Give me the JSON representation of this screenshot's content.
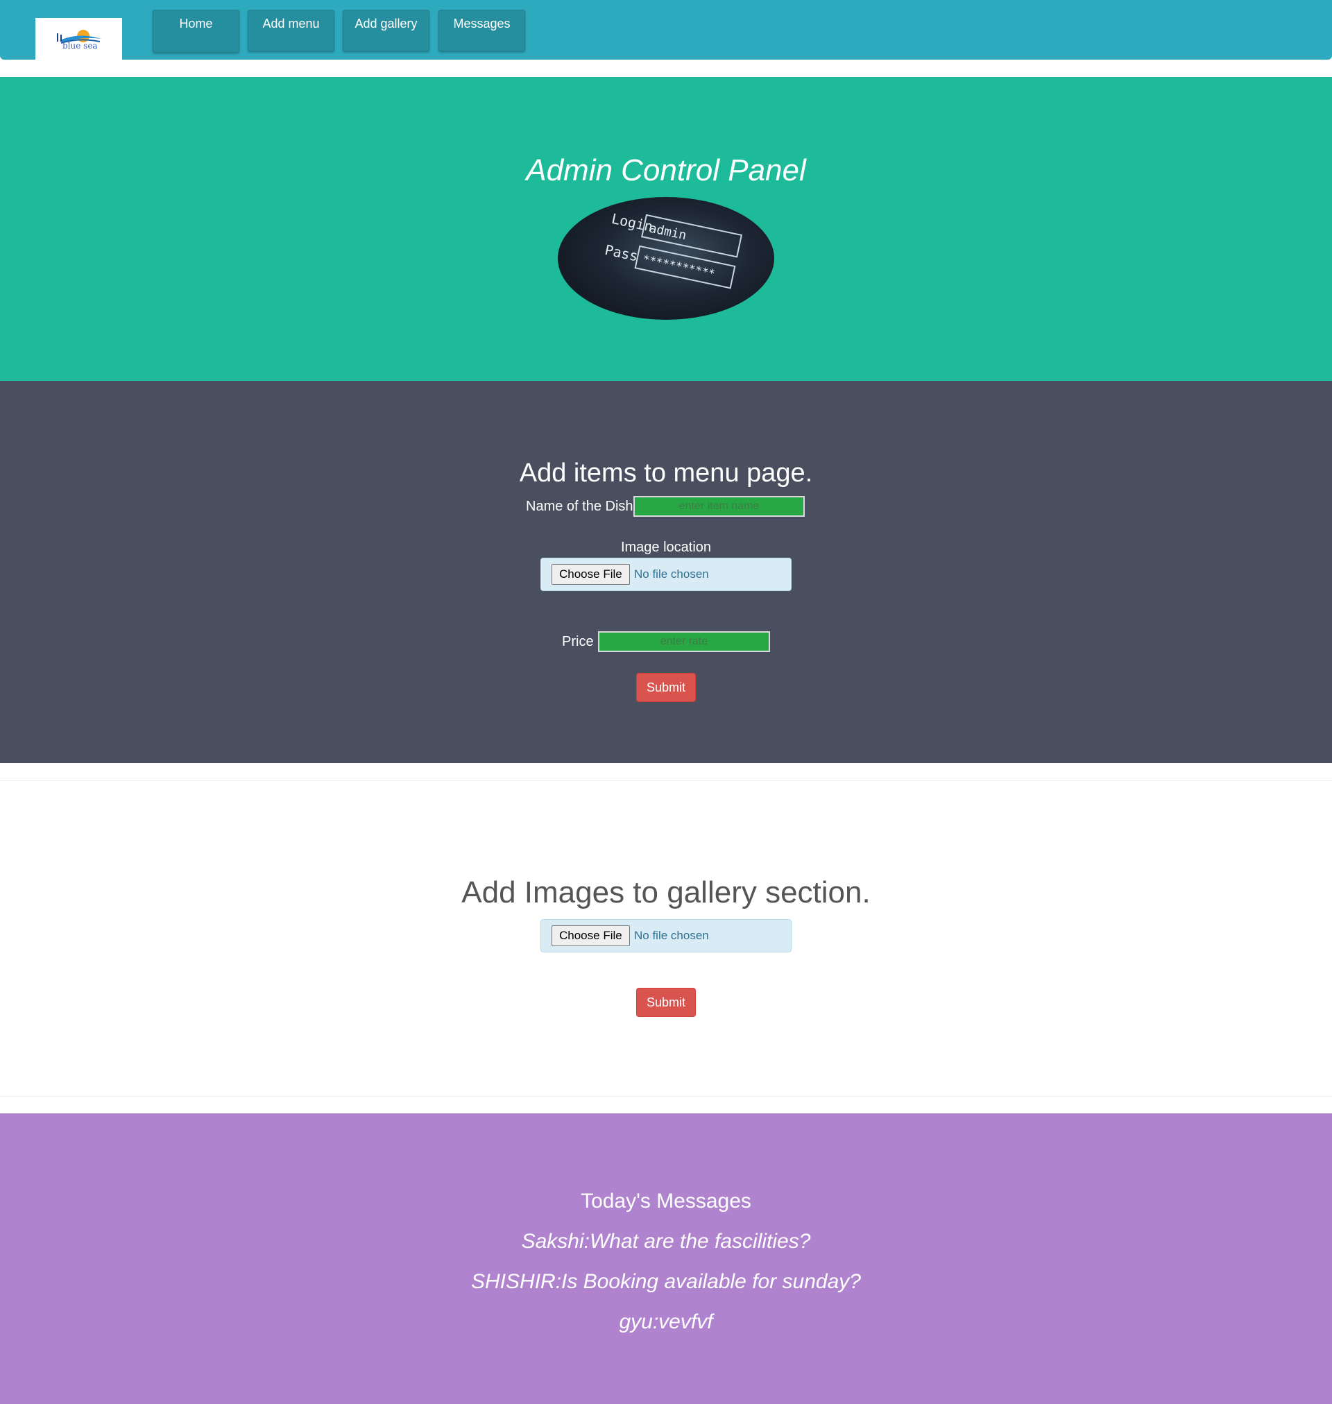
{
  "navbar": {
    "logo_text": "blue sea",
    "items": [
      {
        "label": "Home"
      },
      {
        "label": "Add menu"
      },
      {
        "label": "Add gallery"
      },
      {
        "label": "Messages"
      }
    ]
  },
  "hero": {
    "title": "Admin Control Panel",
    "image": {
      "login_label": "Login",
      "login_value": "admin",
      "pass_label": "Pass",
      "pass_value": "***********"
    }
  },
  "menu_form": {
    "heading": "Add items to menu page.",
    "dish_label": "Name of the Dish",
    "dish_placeholder": "enter item name",
    "image_label": "Image location",
    "file_button": "Choose File",
    "file_status": "No file chosen",
    "price_label": "Price",
    "price_placeholder": "enter rate",
    "submit_label": "Submit"
  },
  "gallery_form": {
    "heading": "Add Images to gallery section.",
    "file_button": "Choose File",
    "file_status": "No file chosen",
    "submit_label": "Submit"
  },
  "messages": {
    "heading": "Today's Messages",
    "items": [
      {
        "text": "Sakshi:What are the fascilities?"
      },
      {
        "text": "SHISHIR:Is Booking available for sunday?"
      },
      {
        "text": "gyu:vevfvf"
      }
    ]
  },
  "colors": {
    "navbar": "#2eaabf",
    "hero": "#1dbb9a",
    "menu_section": "#4a4f5f",
    "messages_section": "#af83cd",
    "submit": "#d9534f",
    "input_green": "#28a745"
  }
}
